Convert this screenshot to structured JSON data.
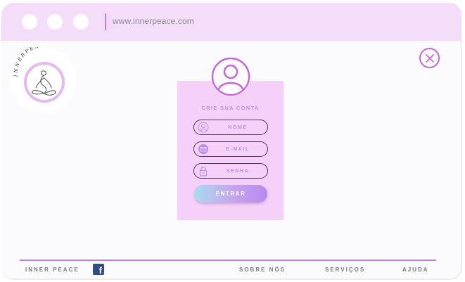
{
  "browser": {
    "address": "www.innerpeace.com"
  },
  "logo": {
    "text": "INNERPEACE"
  },
  "close_icon": "close-icon",
  "form": {
    "title": "CRIE SUA CONTA",
    "fields": [
      {
        "placeholder": "NOME",
        "icon": "user-icon"
      },
      {
        "placeholder": "E-MAIL",
        "icon": "mail-icon"
      },
      {
        "placeholder": "SENHA",
        "icon": "lock-icon"
      }
    ],
    "submit_label": "ENTRAR"
  },
  "footer": {
    "brand": "INNER PEACE",
    "facebook_icon": "facebook-icon",
    "links": [
      "SOBRE NÓS",
      "SERVIÇOS",
      "AJUDA"
    ]
  },
  "colors": {
    "titlebar": "#f4ddf8",
    "accent": "#c77ee3",
    "card": "#f5d1f9",
    "field_text": "#b990df"
  }
}
